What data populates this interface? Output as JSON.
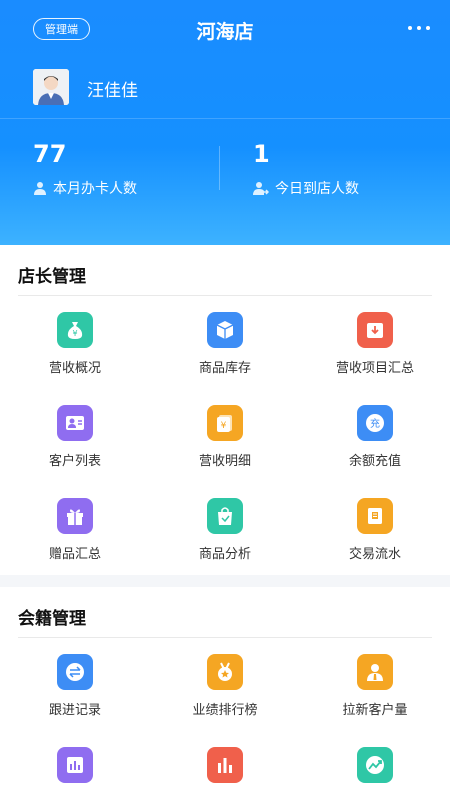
{
  "header": {
    "badge": "管理端",
    "store_name": "河海店",
    "user_name": "汪佳佳",
    "stats": [
      {
        "value": "77",
        "label": "本月办卡人数"
      },
      {
        "value": "1",
        "label": "今日到店人数"
      }
    ]
  },
  "sections": [
    {
      "title": "店长管理",
      "items": [
        {
          "label": "营收概况",
          "icon": "money-bag-icon",
          "color": "#2fc7a6"
        },
        {
          "label": "商品库存",
          "icon": "box-icon",
          "color": "#3d8df5"
        },
        {
          "label": "营收项目汇总",
          "icon": "inbox-icon",
          "color": "#f0604b"
        },
        {
          "label": "客户列表",
          "icon": "contact-card-icon",
          "color": "#8f6df0"
        },
        {
          "label": "营收明细",
          "icon": "yen-document-icon",
          "color": "#f5a623"
        },
        {
          "label": "余额充值",
          "icon": "recharge-icon",
          "color": "#3d8df5"
        },
        {
          "label": "赠品汇总",
          "icon": "gift-icon",
          "color": "#8f6df0"
        },
        {
          "label": "商品分析",
          "icon": "shopping-bag-icon",
          "color": "#2fc7a6"
        },
        {
          "label": "交易流水",
          "icon": "ledger-icon",
          "color": "#f5a623"
        }
      ]
    },
    {
      "title": "会籍管理",
      "items": [
        {
          "label": "跟进记录",
          "icon": "follow-up-icon",
          "color": "#3d8df5"
        },
        {
          "label": "业绩排行榜",
          "icon": "medal-icon",
          "color": "#f5a623"
        },
        {
          "label": "拉新客户量",
          "icon": "new-customer-icon",
          "color": "#f5a623"
        },
        {
          "label": "",
          "icon": "bar-chart-icon",
          "color": "#8f6df0"
        },
        {
          "label": "",
          "icon": "column-chart-icon",
          "color": "#f0604b"
        },
        {
          "label": "",
          "icon": "trend-chart-icon",
          "color": "#2fc7a6"
        }
      ]
    }
  ]
}
